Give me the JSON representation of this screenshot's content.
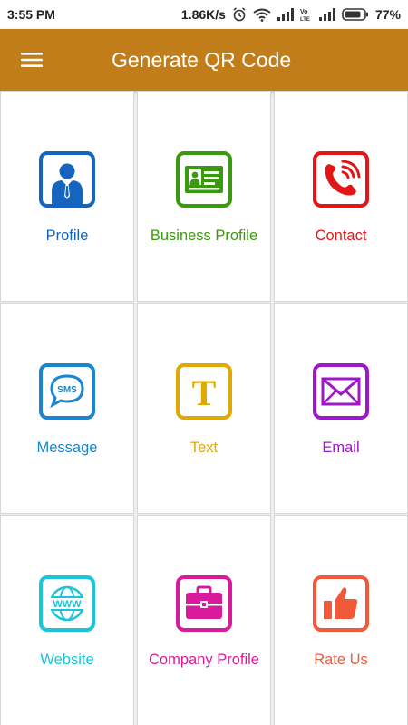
{
  "status_bar": {
    "time": "3:55 PM",
    "network_speed": "1.86K/s",
    "battery": "77%",
    "volte_label": "Vo LTE"
  },
  "app_bar": {
    "title": "Generate QR Code",
    "menu_icon": "hamburger-menu-icon"
  },
  "tiles": [
    {
      "label": "Profile",
      "icon": "person-icon",
      "color": "#1565c0"
    },
    {
      "label": "Business Profile",
      "icon": "id-card-icon",
      "color": "#3a9a0e"
    },
    {
      "label": "Contact",
      "icon": "phone-icon",
      "color": "#e11717"
    },
    {
      "label": "Message",
      "icon": "sms-icon",
      "color": "#1a86cf"
    },
    {
      "label": "Text",
      "icon": "text-t-icon",
      "color": "#e0a800"
    },
    {
      "label": "Email",
      "icon": "envelope-icon",
      "color": "#9e17c9"
    },
    {
      "label": "Website",
      "icon": "www-globe-icon",
      "color": "#1ac4d9"
    },
    {
      "label": "Company Profile",
      "icon": "briefcase-icon",
      "color": "#d81b9c"
    },
    {
      "label": "Rate Us",
      "icon": "thumbs-up-icon",
      "color": "#f05a3a"
    }
  ]
}
